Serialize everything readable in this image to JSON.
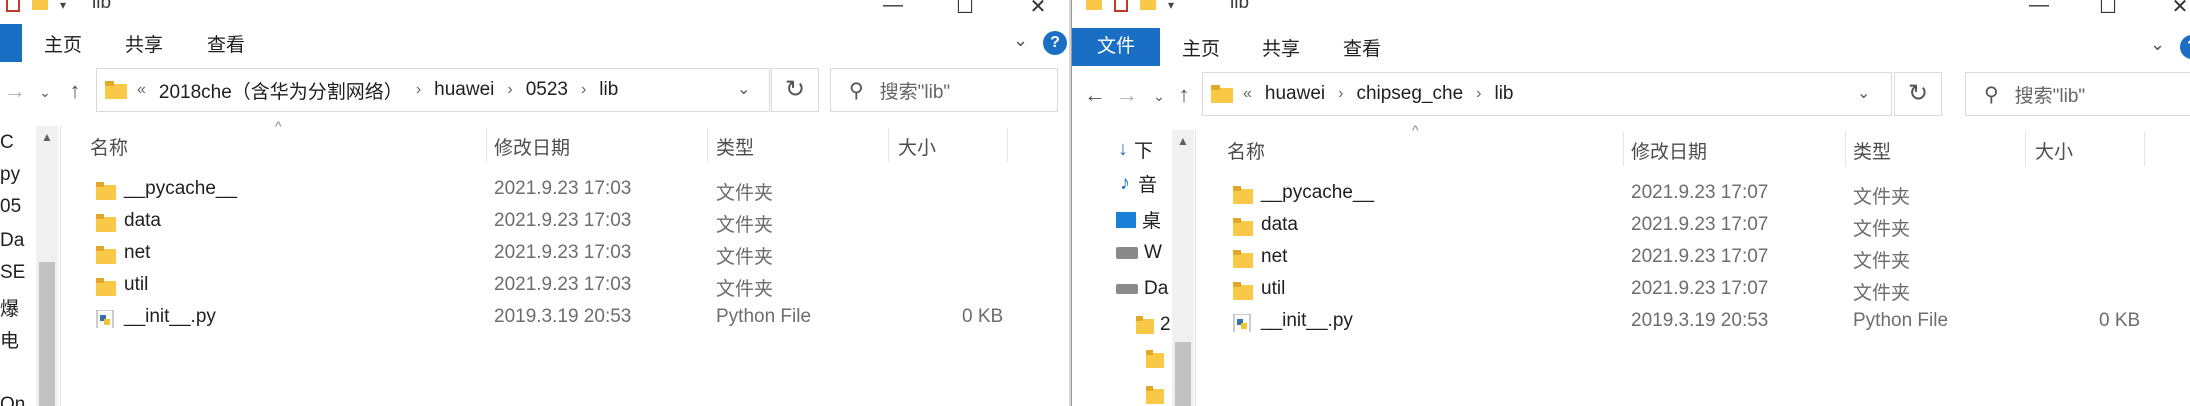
{
  "colors": {
    "accent": "#1a6fc4",
    "folder": "#f8c846",
    "folder_dark": "#e2a826"
  },
  "left": {
    "title": "lib",
    "ribbon": {
      "tabs": [
        "主页",
        "共享",
        "查看"
      ]
    },
    "address": {
      "overflow": "«",
      "crumbs": [
        "2018che（含华为分割网络）",
        "huawei",
        "0523",
        "lib"
      ]
    },
    "search_placeholder": "搜索\"lib\"",
    "nav_items": [
      "C",
      "py",
      "05",
      "Da",
      "SE",
      "爆",
      "电",
      "On"
    ],
    "columns": [
      "名称",
      "修改日期",
      "类型",
      "大小"
    ],
    "files": [
      {
        "name": "__pycache__",
        "date": "2021.9.23 17:03",
        "type": "文件夹",
        "size": "",
        "icon": "folder-icon"
      },
      {
        "name": "data",
        "date": "2021.9.23 17:03",
        "type": "文件夹",
        "size": "",
        "icon": "folder-icon"
      },
      {
        "name": "net",
        "date": "2021.9.23 17:03",
        "type": "文件夹",
        "size": "",
        "icon": "folder-icon"
      },
      {
        "name": "util",
        "date": "2021.9.23 17:03",
        "type": "文件夹",
        "size": "",
        "icon": "folder-icon"
      },
      {
        "name": "__init__.py",
        "date": "2019.3.19 20:53",
        "type": "Python File",
        "size": "0 KB",
        "icon": "python-file-icon"
      }
    ]
  },
  "right": {
    "title": "lib",
    "ribbon": {
      "file_tab": "文件",
      "tabs": [
        "主页",
        "共享",
        "查看"
      ]
    },
    "address": {
      "overflow": "«",
      "crumbs": [
        "huawei",
        "chipseg_che",
        "lib"
      ]
    },
    "search_placeholder": "搜索\"lib\"",
    "nav_items": [
      "下",
      "音",
      "桌",
      "W",
      "Da",
      "2",
      "",
      ""
    ],
    "columns": [
      "名称",
      "修改日期",
      "类型",
      "大小"
    ],
    "files": [
      {
        "name": "__pycache__",
        "date": "2021.9.23 17:07",
        "type": "文件夹",
        "size": "",
        "icon": "folder-icon"
      },
      {
        "name": "data",
        "date": "2021.9.23 17:07",
        "type": "文件夹",
        "size": "",
        "icon": "folder-icon"
      },
      {
        "name": "net",
        "date": "2021.9.23 17:07",
        "type": "文件夹",
        "size": "",
        "icon": "folder-icon"
      },
      {
        "name": "util",
        "date": "2021.9.23 17:07",
        "type": "文件夹",
        "size": "",
        "icon": "folder-icon"
      },
      {
        "name": "__init__.py",
        "date": "2019.3.19 20:53",
        "type": "Python File",
        "size": "0 KB",
        "icon": "python-file-icon"
      }
    ]
  }
}
